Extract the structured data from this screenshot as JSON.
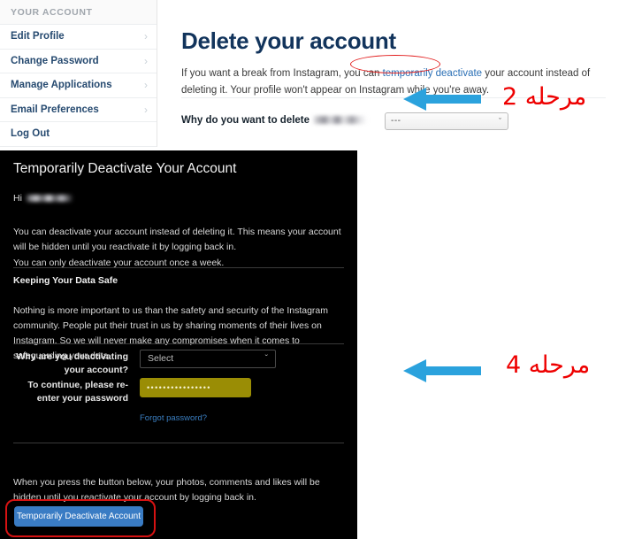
{
  "sidebar": {
    "header": "YOUR ACCOUNT",
    "items": [
      {
        "label": "Edit Profile",
        "chevron": "chevron-right-icon"
      },
      {
        "label": "Change Password",
        "chevron": "chevron-right-icon"
      },
      {
        "label": "Manage Applications",
        "chevron": "chevron-right-icon"
      },
      {
        "label": "Email Preferences",
        "chevron": "chevron-right-icon"
      },
      {
        "label": "Log Out",
        "chevron": ""
      }
    ],
    "chevron_glyph": "›"
  },
  "main": {
    "title": "Delete your account",
    "intro_before": "If you want a break from Instagram, you can ",
    "intro_link": "temporarily deactivate",
    "intro_after": " your account instead of deleting it. Your profile won't appear on Instagram while you're away.",
    "delete_label": "Why do you want to delete",
    "delete_username_blurred": "",
    "reason_select_value": "---",
    "reason_select_chevron": "ˇ"
  },
  "dark_panel": {
    "title": "Temporarily Deactivate Your Account",
    "greeting": "Hi",
    "greeting_username_blurred": "",
    "paragraph_1": "You can deactivate your account instead of deleting it. This means your account will be hidden until you reactivate it by logging back in.",
    "paragraph_2": "You can only deactivate your account once a week.",
    "subheading": "Keeping Your Data Safe",
    "paragraph_3": "Nothing is more important to us than the safety and security of the Instagram community. People put their trust in us by sharing moments of their lives on Instagram. So we will never make any compromises when it comes to safeguarding your data.",
    "field_reason_label": "Why are you deactivating your account?",
    "field_reason_value": "Select",
    "field_reason_chevron": "ˇ",
    "field_password_label": "To continue, please re-enter your password",
    "field_password_value": "••••••••••••••••",
    "forgot_password": "Forgot password?",
    "paragraph_4": "When you press the button below, your photos, comments and likes will be hidden until you reactivate your account by logging back in.",
    "deactivate_button": "Temporarily Deactivate Account"
  },
  "annotations": {
    "step2_text": "مرحله 2",
    "step4_text": "مرحله 4",
    "arrow_color": "#2ba2dd",
    "text_color": "#ee0000",
    "highlight_color": "#d61212"
  },
  "colors": {
    "panel_background": "#000000",
    "page_background": "#ffffff",
    "title_blue": "#12345c",
    "link_blue": "#2a6fb5",
    "button_blue": "#3a7cc4",
    "autofill_olive": "#9a8d05",
    "sidebar_text": "#264a70"
  }
}
